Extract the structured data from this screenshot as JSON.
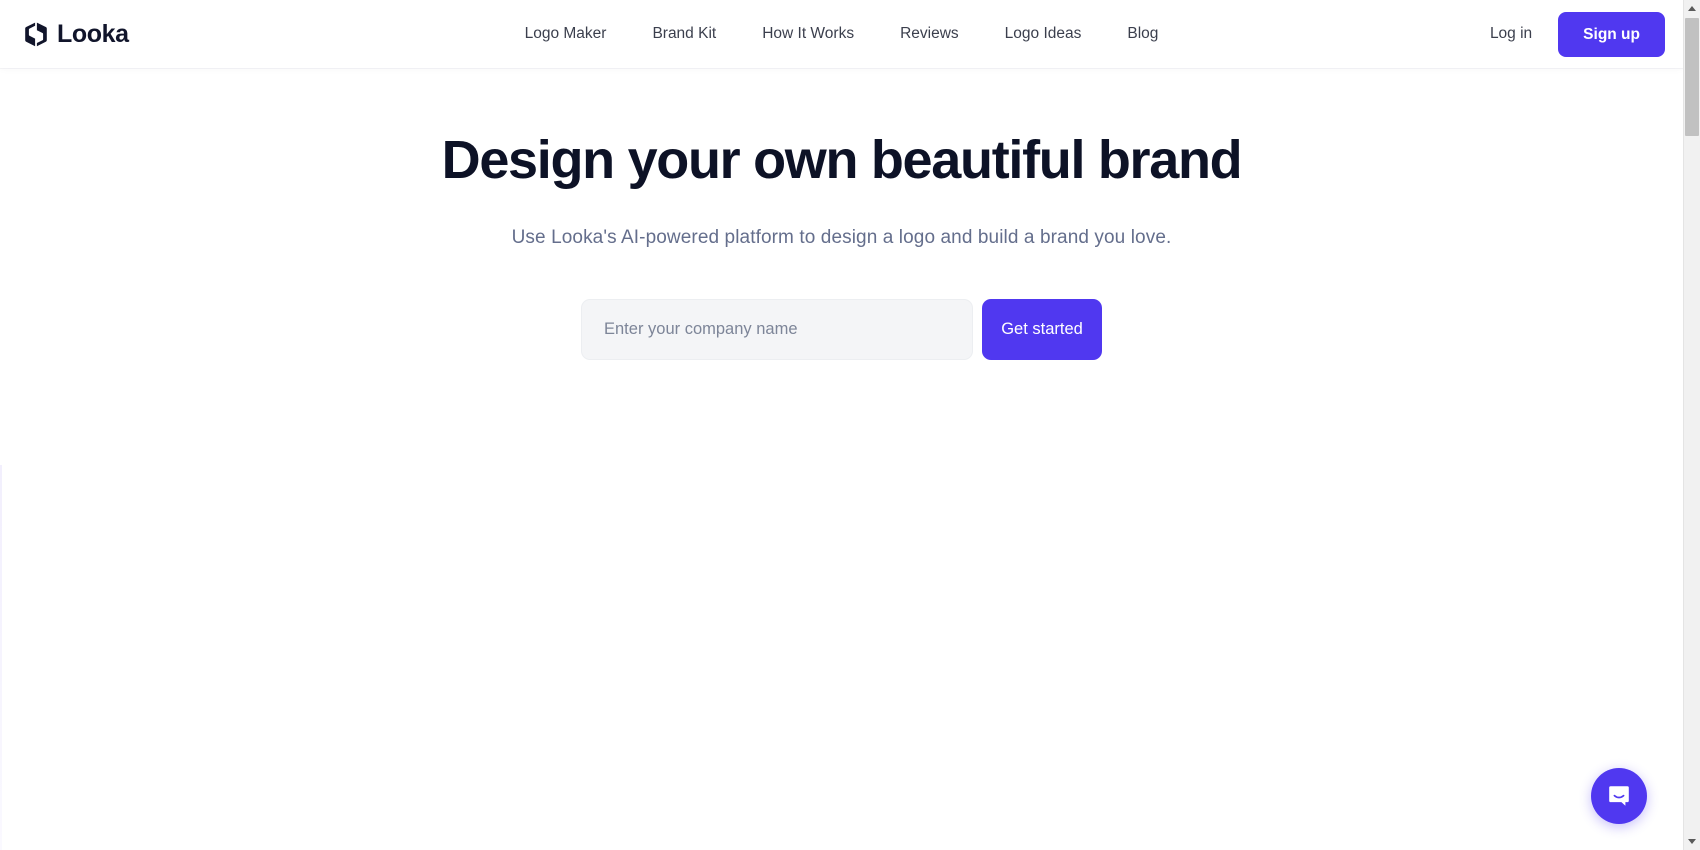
{
  "brand": {
    "name": "Looka",
    "logo_icon": "looka-cube-icon",
    "accent_color": "#5038f0",
    "text_color": "#11152b"
  },
  "header": {
    "nav_items": [
      {
        "label": "Logo Maker"
      },
      {
        "label": "Brand Kit"
      },
      {
        "label": "How It Works"
      },
      {
        "label": "Reviews"
      },
      {
        "label": "Logo Ideas"
      },
      {
        "label": "Blog"
      }
    ],
    "login_label": "Log in",
    "signup_label": "Sign up"
  },
  "hero": {
    "title": "Design your own beautiful brand",
    "subtitle": "Use Looka's AI-powered platform to design a logo and build a brand you love.",
    "input_value": "",
    "input_placeholder": "Enter your company name",
    "cta_label": "Get started",
    "title_color": "#0d1226",
    "subtitle_color": "#646e8c",
    "input_background": "#f4f5f7"
  },
  "chat": {
    "icon": "chat-bubble-smile-icon",
    "background_color": "#5038f0"
  },
  "scrollbar": {
    "up_arrow_icon": "scroll-up-arrow-icon",
    "down_arrow_icon": "scroll-down-arrow-icon",
    "thumb_icon": "scrollbar-thumb"
  }
}
